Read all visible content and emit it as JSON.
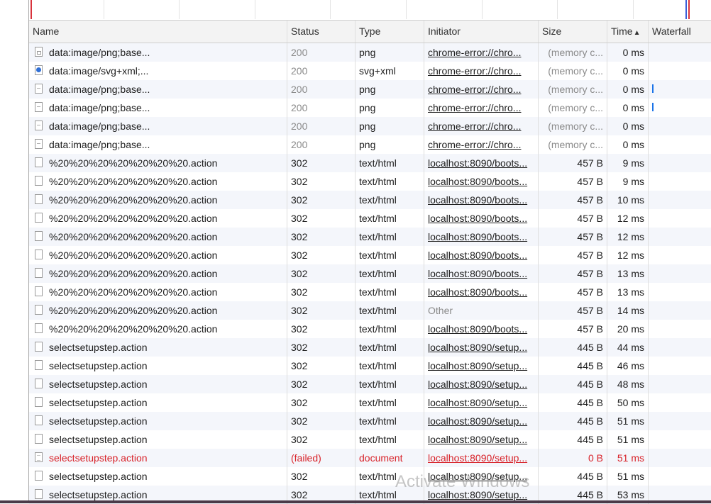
{
  "columns": {
    "name": "Name",
    "status": "Status",
    "type": "Type",
    "initiator": "Initiator",
    "size": "Size",
    "time": "Time",
    "time_sort_indicator": "▲",
    "waterfall": "Waterfall"
  },
  "rows": [
    {
      "name": "data:image/png;base...",
      "status": "200",
      "type": "png",
      "initiator": "chrome-error://chro...",
      "size": "(memory c...",
      "time": "0 ms",
      "icon": "image-file-icon"
    },
    {
      "name": "data:image/svg+xml;...",
      "status": "200",
      "type": "svg+xml",
      "initiator": "chrome-error://chro...",
      "size": "(memory c...",
      "time": "0 ms",
      "icon": "svg-file-icon"
    },
    {
      "name": "data:image/png;base...",
      "status": "200",
      "type": "png",
      "initiator": "chrome-error://chro...",
      "size": "(memory c...",
      "time": "0 ms",
      "icon": "image-file-icon"
    },
    {
      "name": "data:image/png;base...",
      "status": "200",
      "type": "png",
      "initiator": "chrome-error://chro...",
      "size": "(memory c...",
      "time": "0 ms",
      "icon": "image-file-icon"
    },
    {
      "name": "data:image/png;base...",
      "status": "200",
      "type": "png",
      "initiator": "chrome-error://chro...",
      "size": "(memory c...",
      "time": "0 ms",
      "icon": "image-file-icon"
    },
    {
      "name": "data:image/png;base...",
      "status": "200",
      "type": "png",
      "initiator": "chrome-error://chro...",
      "size": "(memory c...",
      "time": "0 ms",
      "icon": "image-file-icon"
    },
    {
      "name": "%20%20%20%20%20%20%20.action",
      "status": "302",
      "type": "text/html",
      "initiator": "localhost:8090/boots...",
      "size": "457 B",
      "time": "9 ms",
      "icon": "document-file-icon"
    },
    {
      "name": "%20%20%20%20%20%20%20.action",
      "status": "302",
      "type": "text/html",
      "initiator": "localhost:8090/boots...",
      "size": "457 B",
      "time": "9 ms",
      "icon": "document-file-icon"
    },
    {
      "name": "%20%20%20%20%20%20%20.action",
      "status": "302",
      "type": "text/html",
      "initiator": "localhost:8090/boots...",
      "size": "457 B",
      "time": "10 ms",
      "icon": "document-file-icon"
    },
    {
      "name": "%20%20%20%20%20%20%20.action",
      "status": "302",
      "type": "text/html",
      "initiator": "localhost:8090/boots...",
      "size": "457 B",
      "time": "12 ms",
      "icon": "document-file-icon"
    },
    {
      "name": "%20%20%20%20%20%20%20.action",
      "status": "302",
      "type": "text/html",
      "initiator": "localhost:8090/boots...",
      "size": "457 B",
      "time": "12 ms",
      "icon": "document-file-icon"
    },
    {
      "name": "%20%20%20%20%20%20%20.action",
      "status": "302",
      "type": "text/html",
      "initiator": "localhost:8090/boots...",
      "size": "457 B",
      "time": "12 ms",
      "icon": "document-file-icon"
    },
    {
      "name": "%20%20%20%20%20%20%20.action",
      "status": "302",
      "type": "text/html",
      "initiator": "localhost:8090/boots...",
      "size": "457 B",
      "time": "13 ms",
      "icon": "document-file-icon"
    },
    {
      "name": "%20%20%20%20%20%20%20.action",
      "status": "302",
      "type": "text/html",
      "initiator": "localhost:8090/boots...",
      "size": "457 B",
      "time": "13 ms",
      "icon": "document-file-icon"
    },
    {
      "name": "%20%20%20%20%20%20%20.action",
      "status": "302",
      "type": "text/html",
      "initiator": "Other",
      "size": "457 B",
      "time": "14 ms",
      "icon": "document-file-icon"
    },
    {
      "name": "%20%20%20%20%20%20%20.action",
      "status": "302",
      "type": "text/html",
      "initiator": "localhost:8090/boots...",
      "size": "457 B",
      "time": "20 ms",
      "icon": "document-file-icon"
    },
    {
      "name": "selectsetupstep.action",
      "status": "302",
      "type": "text/html",
      "initiator": "localhost:8090/setup...",
      "size": "445 B",
      "time": "44 ms",
      "icon": "document-file-icon"
    },
    {
      "name": "selectsetupstep.action",
      "status": "302",
      "type": "text/html",
      "initiator": "localhost:8090/setup...",
      "size": "445 B",
      "time": "46 ms",
      "icon": "document-file-icon"
    },
    {
      "name": "selectsetupstep.action",
      "status": "302",
      "type": "text/html",
      "initiator": "localhost:8090/setup...",
      "size": "445 B",
      "time": "48 ms",
      "icon": "document-file-icon"
    },
    {
      "name": "selectsetupstep.action",
      "status": "302",
      "type": "text/html",
      "initiator": "localhost:8090/setup...",
      "size": "445 B",
      "time": "50 ms",
      "icon": "document-file-icon"
    },
    {
      "name": "selectsetupstep.action",
      "status": "302",
      "type": "text/html",
      "initiator": "localhost:8090/setup...",
      "size": "445 B",
      "time": "51 ms",
      "icon": "document-file-icon"
    },
    {
      "name": "selectsetupstep.action",
      "status": "302",
      "type": "text/html",
      "initiator": "localhost:8090/setup...",
      "size": "445 B",
      "time": "51 ms",
      "icon": "document-file-icon"
    },
    {
      "name": "selectsetupstep.action",
      "status": "(failed)",
      "type": "document",
      "initiator": "localhost:8090/setup...",
      "size": "0 B",
      "time": "51 ms",
      "icon": "document-lines-icon",
      "failed": true
    },
    {
      "name": "selectsetupstep.action",
      "status": "302",
      "type": "text/html",
      "initiator": "localhost:8090/setup...",
      "size": "445 B",
      "time": "51 ms",
      "icon": "document-file-icon"
    },
    {
      "name": "selectsetupstep.action",
      "status": "302",
      "type": "text/html",
      "initiator": "localhost:8090/setup...",
      "size": "445 B",
      "time": "53 ms",
      "icon": "document-file-icon"
    }
  ],
  "watermark": "Activate Windows",
  "colors": {
    "failed_text": "#d8232a",
    "link_blue": "#1a73e8",
    "alt_row": "#f4f6fb",
    "header_bg": "#f3f3f3"
  }
}
